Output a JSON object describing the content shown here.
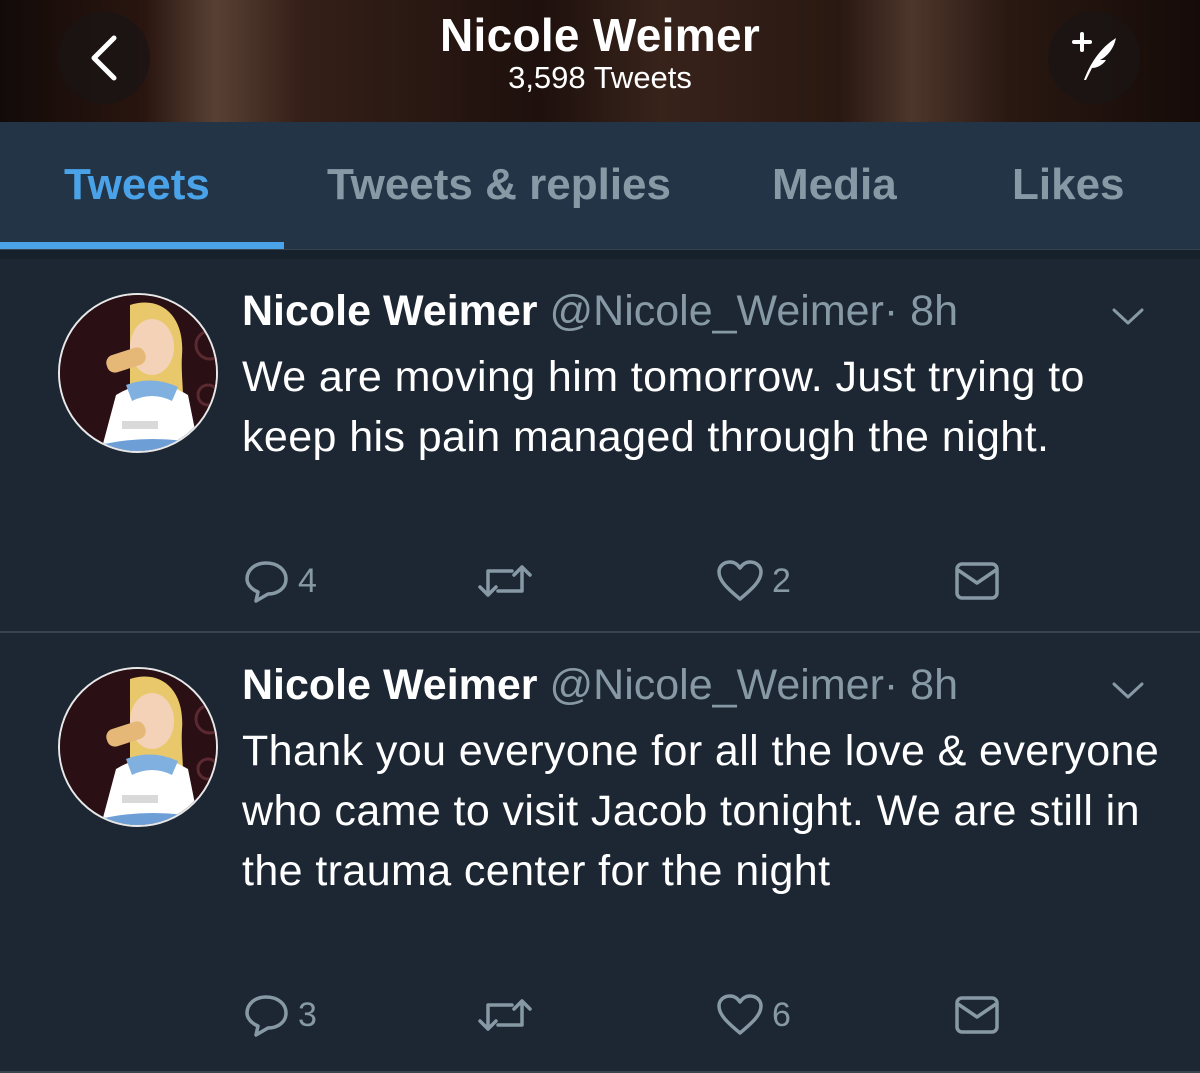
{
  "header": {
    "title": "Nicole Weimer",
    "subtitle": "3,598 Tweets",
    "back_icon": "chevron-left-icon",
    "compose_icon": "compose-tweet-icon"
  },
  "tabs": [
    {
      "label": "Tweets",
      "active": true
    },
    {
      "label": "Tweets & replies",
      "active": false
    },
    {
      "label": "Media",
      "active": false
    },
    {
      "label": "Likes",
      "active": false
    }
  ],
  "colors": {
    "accent": "#4aa3e8",
    "background": "#1c2733",
    "tab_bar": "#243447",
    "muted": "#8899a6"
  },
  "tweets": [
    {
      "name": "Nicole Weimer",
      "handle": "@Nicole_Weimer",
      "time": "· 8h",
      "text": "We are moving him tomorrow. Just trying to keep his pain managed through the night.",
      "replies": "4",
      "retweets": "",
      "likes": "2"
    },
    {
      "name": "Nicole Weimer",
      "handle": "@Nicole_Weimer",
      "time": "· 8h",
      "text": "Thank you everyone for all the love & everyone who came to visit Jacob tonight. We are still in the trauma center for the night",
      "replies": "3",
      "retweets": "",
      "likes": "6"
    }
  ]
}
